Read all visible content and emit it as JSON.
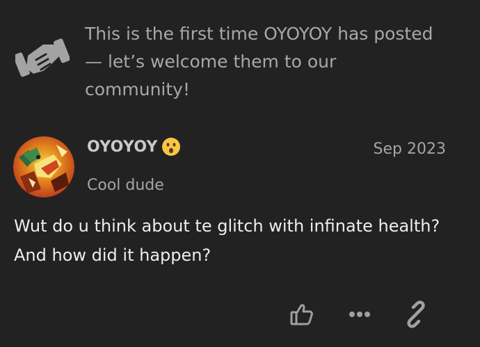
{
  "notice": {
    "icon": "handshake-icon",
    "text": "This is the first time OYOYOY has posted — let’s welcome them to our community!"
  },
  "post": {
    "avatar_icon": "avatar-image",
    "username": "OYOYOY",
    "status_emoji": "astonished-face-emoji",
    "date": "Sep 2023",
    "user_title": "Cool dude",
    "body": "Wut do u think about te glitch with infinate health? And how did it happen?"
  },
  "actions": {
    "like_icon": "thumbs-up-icon",
    "more_icon": "more-options-icon",
    "share_icon": "link-icon"
  },
  "colors": {
    "background": "#222222",
    "muted_text": "#a8a8a8",
    "body_text": "#ededed",
    "icon_gray": "#a0a0a0",
    "emoji_yellow": "#f7c646"
  }
}
